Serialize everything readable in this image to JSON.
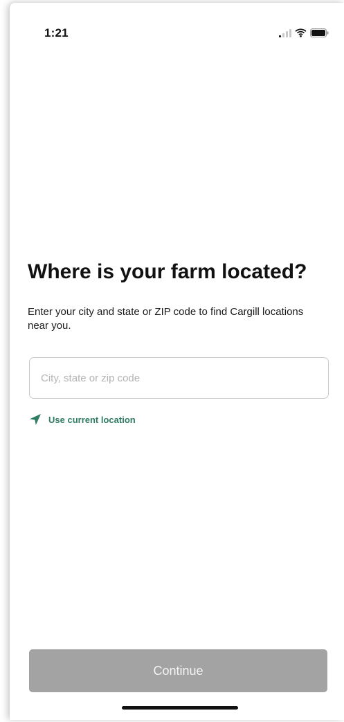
{
  "status_bar": {
    "time": "1:21",
    "icons": [
      "cellular-signal-icon",
      "wifi-icon",
      "battery-icon"
    ]
  },
  "main": {
    "title": "Where is your farm located?",
    "subtitle": "Enter your city and state or ZIP code to find Cargill locations near you.",
    "location_input": {
      "value": "",
      "placeholder": "City, state or zip code"
    },
    "use_current_location": {
      "label": "Use current location",
      "icon": "location-arrow-icon"
    }
  },
  "footer": {
    "continue_label": "Continue"
  },
  "colors": {
    "accent": "#2e7d63",
    "button_disabled": "#a3a3a3",
    "title": "#111111"
  }
}
